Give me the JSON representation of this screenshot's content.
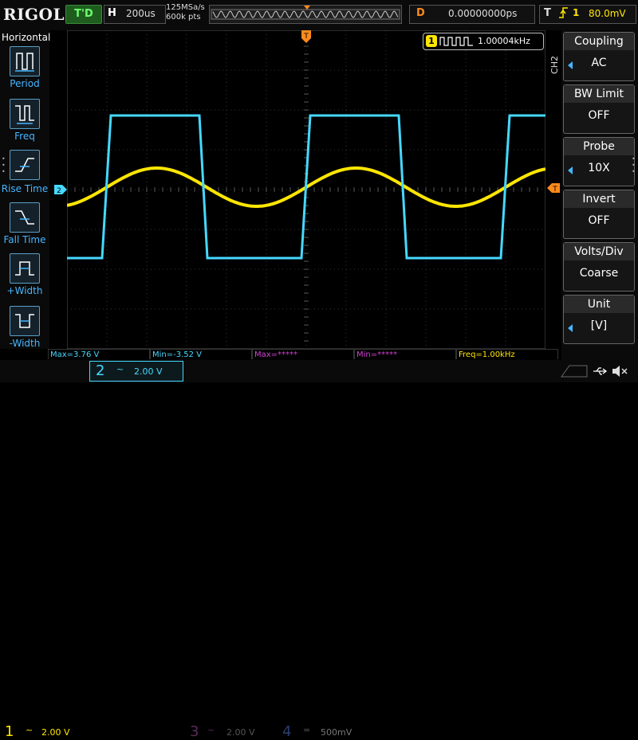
{
  "header": {
    "logo": "RIGOL",
    "trigger_status": "T'D",
    "horizontal_label": "H",
    "timebase": "200us",
    "sample_rate": "125MSa/s",
    "memory_depth": "600k pts",
    "delay_label": "D",
    "delay_value": "0.00000000ps",
    "trigger_label": "T",
    "trigger_source": "1",
    "trigger_level": "80.0mV"
  },
  "left_menu": {
    "title": "Horizontal",
    "items": [
      {
        "label": "Period",
        "icon": "period-icon"
      },
      {
        "label": "Freq",
        "icon": "frequency-icon"
      },
      {
        "label": "Rise Time",
        "icon": "rise-time-icon"
      },
      {
        "label": "Fall Time",
        "icon": "fall-time-icon"
      },
      {
        "label": "+Width",
        "icon": "positive-width-icon"
      },
      {
        "label": "-Width",
        "icon": "negative-width-icon"
      }
    ]
  },
  "freq_counter": {
    "channel": "1",
    "value": "1.00004kHz"
  },
  "markers": {
    "trigger_position": "T",
    "ch2_offset": "2",
    "trigger_level": "T"
  },
  "measurements": [
    {
      "text": "Max=3.76 V",
      "color": "#46d8ff"
    },
    {
      "text": "Min=-3.52 V",
      "color": "#46d8ff"
    },
    {
      "text": "Max=*****",
      "color": "#d040d0"
    },
    {
      "text": "Min=*****",
      "color": "#d040d0"
    },
    {
      "text": "Freq=1.00kHz",
      "color": "#ffe600"
    }
  ],
  "channels": [
    {
      "num": "1",
      "coupling": "~",
      "scale": "2.00 V",
      "color": "#ffe600",
      "active": true
    },
    {
      "num": "2",
      "coupling": "~",
      "scale": "2.00 V",
      "color": "#46d8ff",
      "active": true
    },
    {
      "num": "3",
      "coupling": "~",
      "scale": "2.00 V",
      "color": "#c040c0",
      "active": false
    },
    {
      "num": "4",
      "coupling": "=",
      "scale": "500mV",
      "color": "#3060c0",
      "active": false
    }
  ],
  "right_menu": {
    "channel_tag": "CH2",
    "items": [
      {
        "title": "Coupling",
        "value": "AC",
        "has_arrow": true
      },
      {
        "title": "BW Limit",
        "value": "OFF",
        "has_arrow": false
      },
      {
        "title": "Probe",
        "value": "10X",
        "has_arrow": true
      },
      {
        "title": "Invert",
        "value": "OFF",
        "has_arrow": false
      },
      {
        "title": "Volts/Div",
        "value": "Coarse",
        "has_arrow": false
      },
      {
        "title": "Unit",
        "value": "[V]",
        "has_arrow": true
      }
    ]
  },
  "colors": {
    "ch1": "#ffe600",
    "ch2": "#46d8ff",
    "trigger": "#ff8a1c",
    "accent": "#46b6ff"
  }
}
